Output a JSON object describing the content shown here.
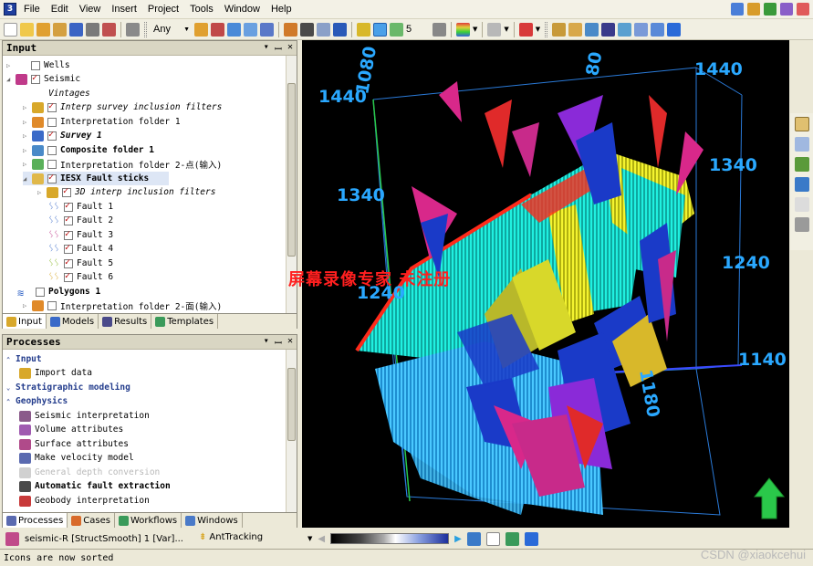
{
  "app": {
    "icon_label": "3"
  },
  "menu": [
    "File",
    "Edit",
    "View",
    "Insert",
    "Project",
    "Tools",
    "Window",
    "Help"
  ],
  "toolbar": {
    "filter_value": "Any",
    "number_value": "5"
  },
  "input_pane": {
    "title": "Input",
    "items": [
      {
        "label": "Wells"
      },
      {
        "label": "Seismic"
      },
      {
        "label": "Vintages"
      },
      {
        "label": "Interp survey inclusion filters"
      },
      {
        "label": "Interpretation folder 1"
      },
      {
        "label": "Survey 1"
      },
      {
        "label": "Composite folder 1"
      },
      {
        "label": "Interpretation folder 2-点(输入)"
      },
      {
        "label": "IESX Fault sticks"
      },
      {
        "label": "3D interp inclusion filters"
      },
      {
        "label": "Fault 1"
      },
      {
        "label": "Fault 2"
      },
      {
        "label": "Fault 3"
      },
      {
        "label": "Fault 4"
      },
      {
        "label": "Fault 5"
      },
      {
        "label": "Fault 6"
      },
      {
        "label": "Polygons 1"
      },
      {
        "label": "Interpretation folder 2-面(输入)"
      }
    ],
    "tabs": [
      "Input",
      "Models",
      "Results",
      "Templates"
    ]
  },
  "processes_pane": {
    "title": "Processes",
    "items": [
      {
        "label": "Input"
      },
      {
        "label": "Import data"
      },
      {
        "label": "Stratigraphic modeling"
      },
      {
        "label": "Geophysics"
      },
      {
        "label": "Seismic interpretation"
      },
      {
        "label": "Volume attributes"
      },
      {
        "label": "Surface attributes"
      },
      {
        "label": "Make velocity model"
      },
      {
        "label": "General depth conversion"
      },
      {
        "label": "Automatic fault extraction"
      },
      {
        "label": "Geobody interpretation"
      }
    ],
    "tabs": [
      "Processes",
      "Cases",
      "Workflows",
      "Windows"
    ]
  },
  "bottom": {
    "seismic_label": "seismic-R [StructSmooth] 1 [Var]...",
    "tracking_label": "AntTracking"
  },
  "status": "Icons are now sorted",
  "viewport": {
    "overlay_text": "屏幕录像专家 未注册",
    "axis_labels": [
      "1080",
      "80",
      "1440",
      "1440",
      "1340",
      "1340",
      "1240",
      "1240",
      "1140",
      "1180"
    ]
  },
  "watermark": "CSDN @xiaokcehui",
  "colors": {
    "accent": "#233c8c",
    "fault_cyan": "#1fe0d0",
    "fault_yellow": "#e6e61a",
    "fault_red": "#ff2a1a",
    "axis_blue": "#2aa8ff"
  }
}
